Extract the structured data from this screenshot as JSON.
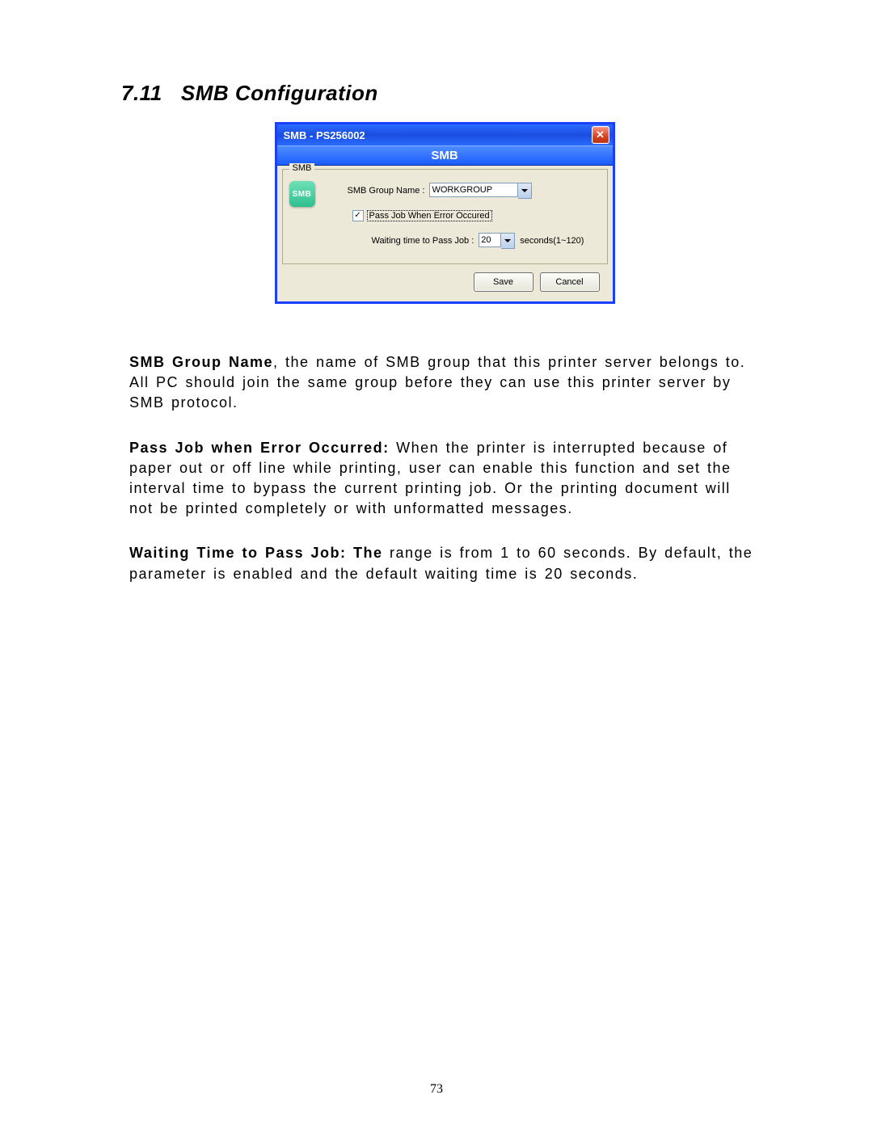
{
  "section": {
    "number": "7.11",
    "title": "SMB Configuration"
  },
  "dialog": {
    "title": "SMB - PS256002",
    "header": "SMB",
    "group_legend": "SMB",
    "icon_text": "SMB",
    "group_name_label": "SMB Group Name :",
    "group_name_value": "WORKGROUP",
    "pass_job_checked": "✓",
    "pass_job_label": "Pass Job When Error Occured",
    "waiting_label": "Waiting time to Pass Job :",
    "waiting_value": "20",
    "waiting_suffix": "seconds(1~120)",
    "save_label": "Save",
    "cancel_label": "Cancel"
  },
  "body": {
    "p1_bold": "SMB Group Name",
    "p1_rest": ", the name of SMB group that this printer server belongs to. All PC should join the same group before they can use this printer server by SMB protocol.",
    "p2_bold": "Pass Job when Error Occurred:",
    "p2_rest": " When the printer is interrupted because of paper out or off line while printing, user can enable this function and set the interval time to bypass the current printing job. Or the printing document will not be printed completely or with unformatted messages.",
    "p3_bold": "Waiting Time to Pass Job: The ",
    "p3_rest": "range is from 1 to 60 seconds. By default, the parameter is enabled and the default waiting time is 20 seconds."
  },
  "page_number": "73"
}
